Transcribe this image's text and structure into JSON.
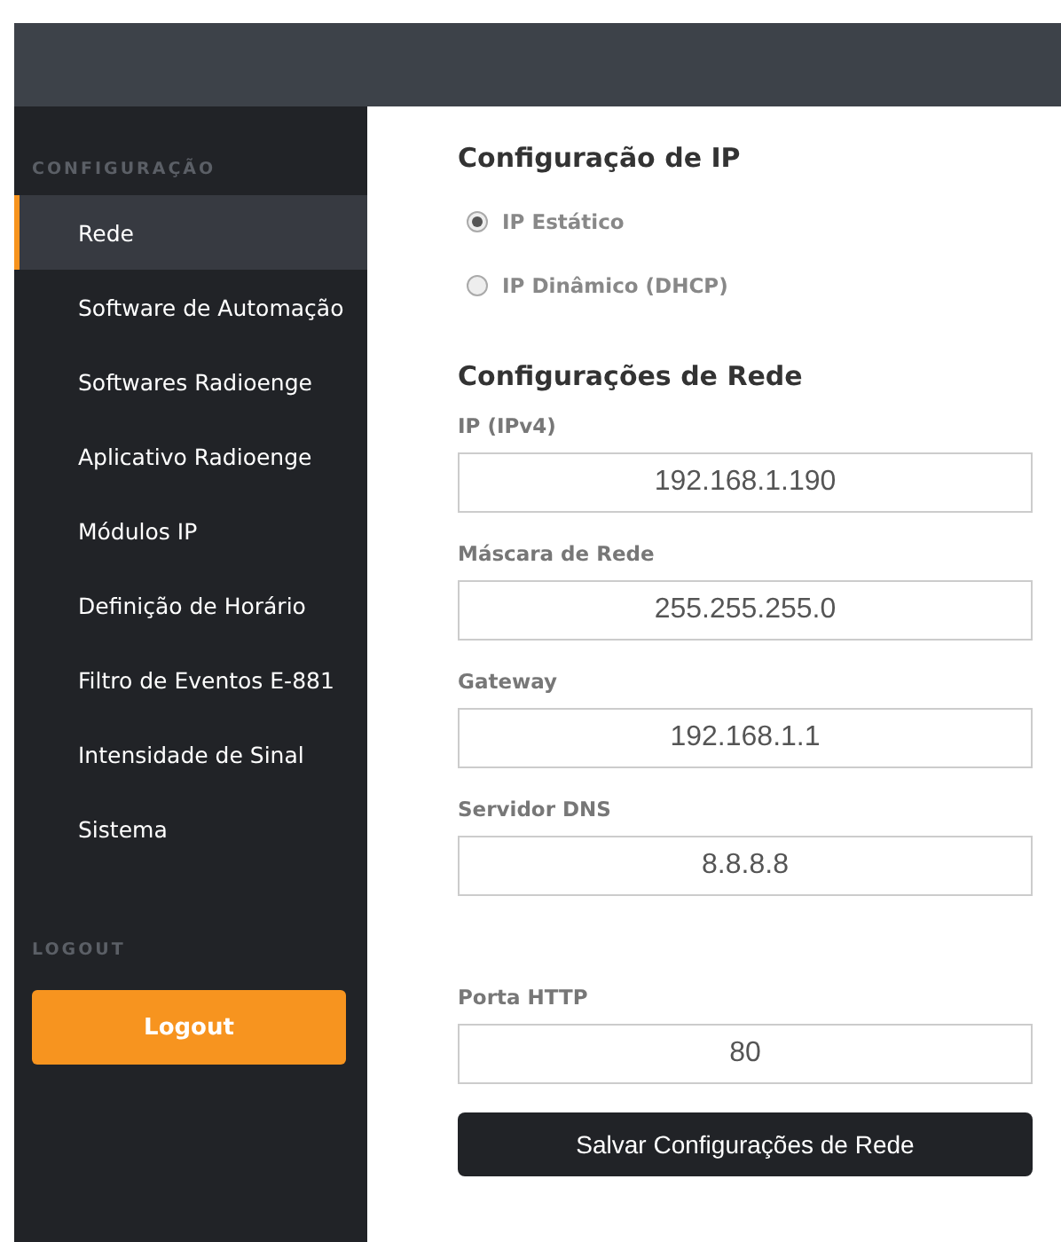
{
  "sidebar": {
    "section_label": "CONFIGURAÇÃO",
    "items": [
      {
        "label": "Rede",
        "selected": true
      },
      {
        "label": "Software de Automação",
        "selected": false
      },
      {
        "label": "Softwares Radioenge",
        "selected": false
      },
      {
        "label": "Aplicativo Radioenge",
        "selected": false
      },
      {
        "label": "Módulos IP",
        "selected": false
      },
      {
        "label": "Definição de Horário",
        "selected": false
      },
      {
        "label": "Filtro de Eventos E-881",
        "selected": false
      },
      {
        "label": "Intensidade de Sinal",
        "selected": false
      },
      {
        "label": "Sistema",
        "selected": false
      }
    ],
    "logout_label": "LOGOUT",
    "logout_button": "Logout"
  },
  "ip_config": {
    "title": "Configuração de IP",
    "options": [
      {
        "label": "IP Estático",
        "selected": true
      },
      {
        "label": "IP Dinâmico (DHCP)",
        "selected": false
      }
    ]
  },
  "network": {
    "title": "Configurações de Rede",
    "fields": [
      {
        "label": "IP (IPv4)",
        "value": "192.168.1.190"
      },
      {
        "label": "Máscara de Rede",
        "value": "255.255.255.0"
      },
      {
        "label": "Gateway",
        "value": "192.168.1.1"
      },
      {
        "label": "Servidor DNS",
        "value": "8.8.8.8"
      }
    ],
    "port_field": {
      "label": "Porta HTTP",
      "value": "80"
    },
    "save_button": "Salvar Configurações de Rede"
  }
}
